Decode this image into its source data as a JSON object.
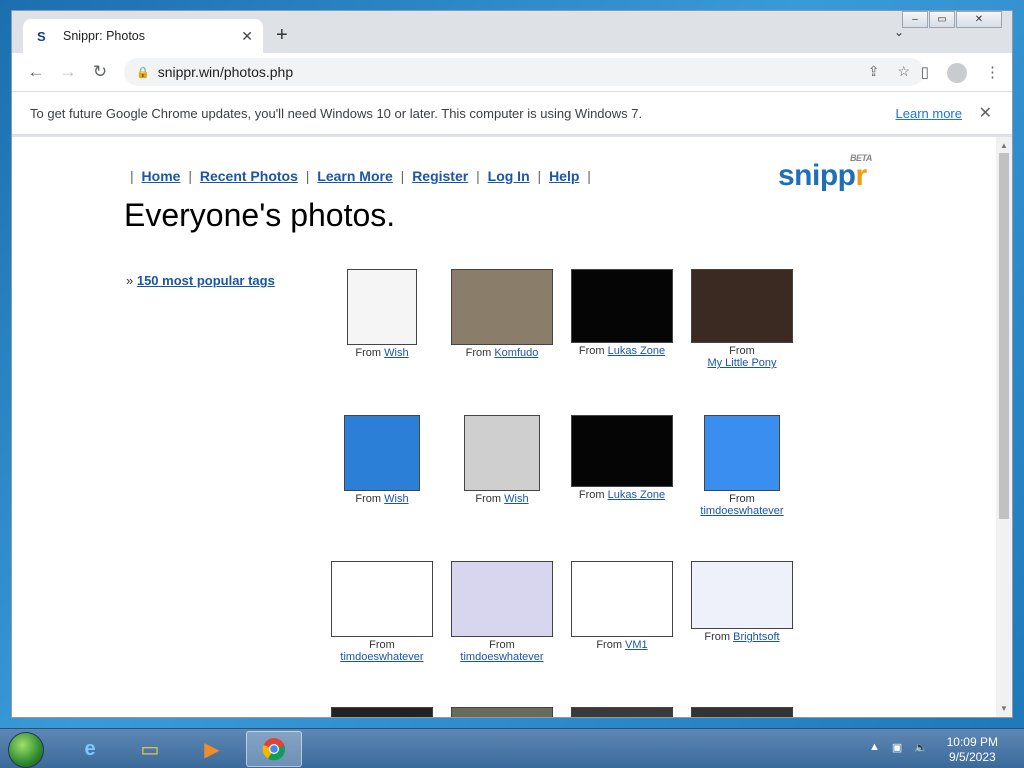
{
  "browser": {
    "tab_title": "Snippr: Photos",
    "url": "snippr.win/photos.php",
    "infobar_text": "To get future Google Chrome updates, you'll need Windows 10 or later. This computer is using Windows 7.",
    "infobar_link": "Learn more"
  },
  "site": {
    "logo": "snipp",
    "logo_r": "r",
    "logo_beta": "BETA",
    "nav": [
      "Home",
      "Recent Photos",
      "Learn More",
      "Register",
      "Log In",
      "Help"
    ],
    "heading": "Everyone's photos.",
    "tags_link": "150 most popular tags"
  },
  "photos": [
    {
      "from": "From",
      "user": "Wish",
      "thumb_color": "#f5f5f5"
    },
    {
      "from": "From",
      "user": "Komfudo",
      "thumb_color": "#8a7d6a"
    },
    {
      "from": "From",
      "user": "Lukas Zone",
      "thumb_color": "#050505"
    },
    {
      "from": "From",
      "user": "My Little Pony",
      "thumb_color": "#3a2a22"
    },
    {
      "from": "From",
      "user": "Wish",
      "thumb_color": "#2b7fd6"
    },
    {
      "from": "From",
      "user": "Wish",
      "thumb_color": "#cfcfcf"
    },
    {
      "from": "From",
      "user": "Lukas Zone",
      "thumb_color": "#050505"
    },
    {
      "from": "From",
      "user": "timdoeswhatever",
      "thumb_color": "#3a8ef0"
    },
    {
      "from": "From",
      "user": "timdoeswhatever",
      "thumb_color": "#ffffff"
    },
    {
      "from": "From",
      "user": "timdoeswhatever",
      "thumb_color": "#d8d6ee"
    },
    {
      "from": "From",
      "user": "VM1",
      "thumb_color": "#ffffff"
    },
    {
      "from": "From",
      "user": "Brightsoft",
      "thumb_color": "#eef0fa"
    }
  ],
  "taskbar": {
    "time": "10:09 PM",
    "date": "9/5/2023"
  }
}
